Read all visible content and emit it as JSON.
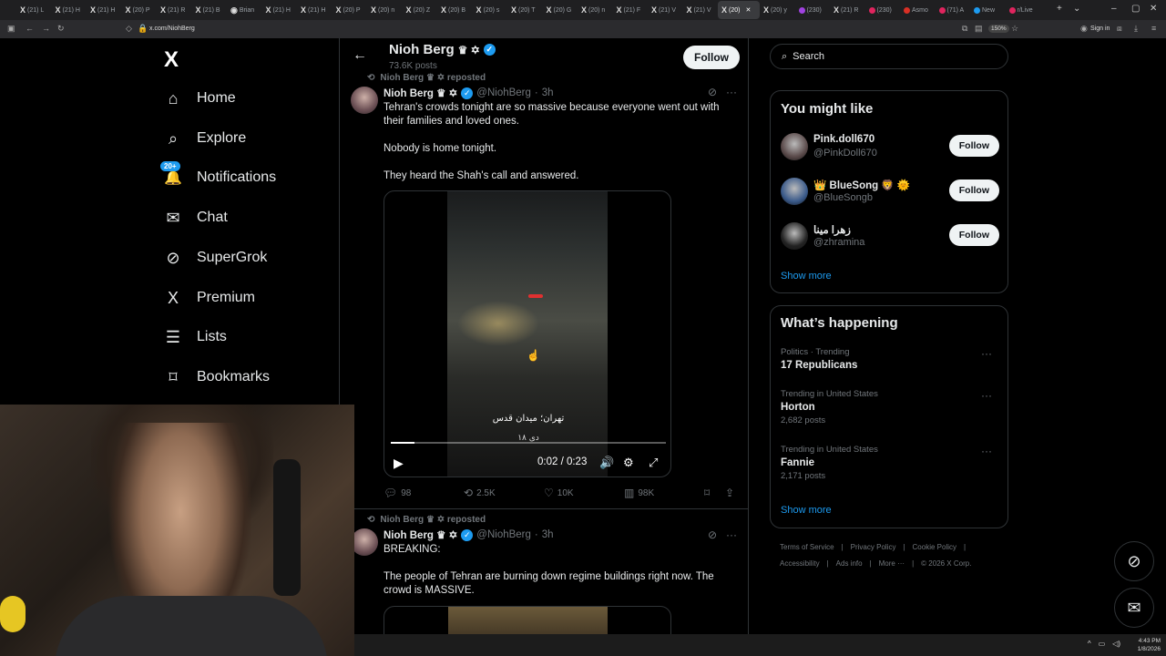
{
  "browser": {
    "tabs": [
      {
        "icon": "X",
        "label": "(21) L"
      },
      {
        "icon": "X",
        "label": "(21) H"
      },
      {
        "icon": "X",
        "label": "(21) H"
      },
      {
        "icon": "X",
        "label": "(20) P"
      },
      {
        "icon": "X",
        "label": "(21) R"
      },
      {
        "icon": "X",
        "label": "(21) B"
      },
      {
        "icon": "◉",
        "label": "Brian"
      },
      {
        "icon": "X",
        "label": "(21) H"
      },
      {
        "icon": "X",
        "label": "(21) H"
      },
      {
        "icon": "X",
        "label": "(20) P"
      },
      {
        "icon": "X",
        "label": "(20) n"
      },
      {
        "icon": "X",
        "label": "(20) Z"
      },
      {
        "icon": "X",
        "label": "(20) B"
      },
      {
        "icon": "X",
        "label": "(20) s"
      },
      {
        "icon": "X",
        "label": "(20) T"
      },
      {
        "icon": "X",
        "label": "(20) G"
      },
      {
        "icon": "X",
        "label": "(20) n"
      },
      {
        "icon": "X",
        "label": "(21) F"
      },
      {
        "icon": "X",
        "label": "(21) V"
      },
      {
        "icon": "X",
        "label": "(21) V"
      },
      {
        "icon": "X",
        "label": "(20)",
        "active": true
      },
      {
        "icon": "X",
        "label": "(20) y"
      },
      {
        "icon": "●",
        "label": "(230)"
      },
      {
        "icon": "X",
        "label": "(21) R"
      },
      {
        "icon": "●",
        "label": "(230)"
      },
      {
        "icon": "●",
        "label": "Asmo"
      },
      {
        "icon": "●",
        "label": "(71) A"
      },
      {
        "icon": "●",
        "label": "New"
      },
      {
        "icon": "●",
        "label": "r/Live"
      }
    ],
    "url": "x.com/NiohBerg",
    "zoom": "150%",
    "signin": "Sign in"
  },
  "nav": {
    "logo": "X",
    "items": [
      {
        "label": "Home",
        "icon": "⌂"
      },
      {
        "label": "Explore",
        "icon": "⌕"
      },
      {
        "label": "Notifications",
        "icon": "🔔",
        "badge": "20+"
      },
      {
        "label": "Chat",
        "icon": "✉"
      },
      {
        "label": "SuperGrok",
        "icon": "⊘"
      },
      {
        "label": "Premium",
        "icon": "X"
      },
      {
        "label": "Lists",
        "icon": "☰"
      },
      {
        "label": "Bookmarks",
        "icon": "⌑"
      }
    ]
  },
  "profile": {
    "name": "Nioh Berg",
    "name_badges": "♛ ✡",
    "posts": "73.6K posts",
    "follow": "Follow"
  },
  "tweets": [
    {
      "repost_label": "Nioh Berg ♛ ✡ reposted",
      "name": "Nioh Berg ♛ ✡",
      "handle": "@NiohBerg",
      "time": "3h",
      "text": [
        "Tehran's crowds tonight are so massive because everyone went out with their families and loved ones.",
        "Nobody is home tonight.",
        "They heard the Shah's call and answered."
      ],
      "video": {
        "caption": "تهران؛ میدان قدس",
        "subcaption": "۱۸ دی",
        "time": "0:02 / 0:23",
        "progress": 0.087
      },
      "stats": {
        "replies": "98",
        "reposts": "2.5K",
        "likes": "10K",
        "views": "98K"
      }
    },
    {
      "repost_label": "Nioh Berg ♛ ✡ reposted",
      "name": "Nioh Berg ♛ ✡",
      "handle": "@NiohBerg",
      "time": "3h",
      "text": [
        "BREAKING:",
        "The people of Tehran are burning down regime buildings right now. The crowd is MASSIVE."
      ]
    }
  ],
  "right": {
    "search_placeholder": "Search",
    "might_like_title": "You might like",
    "suggestions": [
      {
        "name": "Pink.doll670",
        "handle": "@PinkDoll670",
        "follow": "Follow",
        "color": "#5a4a4a"
      },
      {
        "name": "👑 BlueSong 🦁 🌞",
        "handle": "@BlueSongb",
        "follow": "Follow",
        "color": "#3a5a8a"
      },
      {
        "name": "زهرا مینا",
        "handle": "@zhramina",
        "follow": "Follow",
        "color": "#222222"
      }
    ],
    "show_more": "Show more",
    "happening_title": "What’s happening",
    "trends": [
      {
        "context": "Politics · Trending",
        "name": "17 Republicans",
        "posts": ""
      },
      {
        "context": "Trending in United States",
        "name": "Horton",
        "posts": "2,682 posts"
      },
      {
        "context": "Trending in United States",
        "name": "Fannie",
        "posts": "2,171 posts"
      }
    ],
    "show_more2": "Show more",
    "footer": [
      "Terms of Service",
      "Privacy Policy",
      "Cookie Policy",
      "Accessibility",
      "Ads info",
      "More ···",
      "© 2026 X Corp."
    ]
  },
  "taskbar": {
    "time": "4:43 PM",
    "date": "1/8/2026"
  }
}
